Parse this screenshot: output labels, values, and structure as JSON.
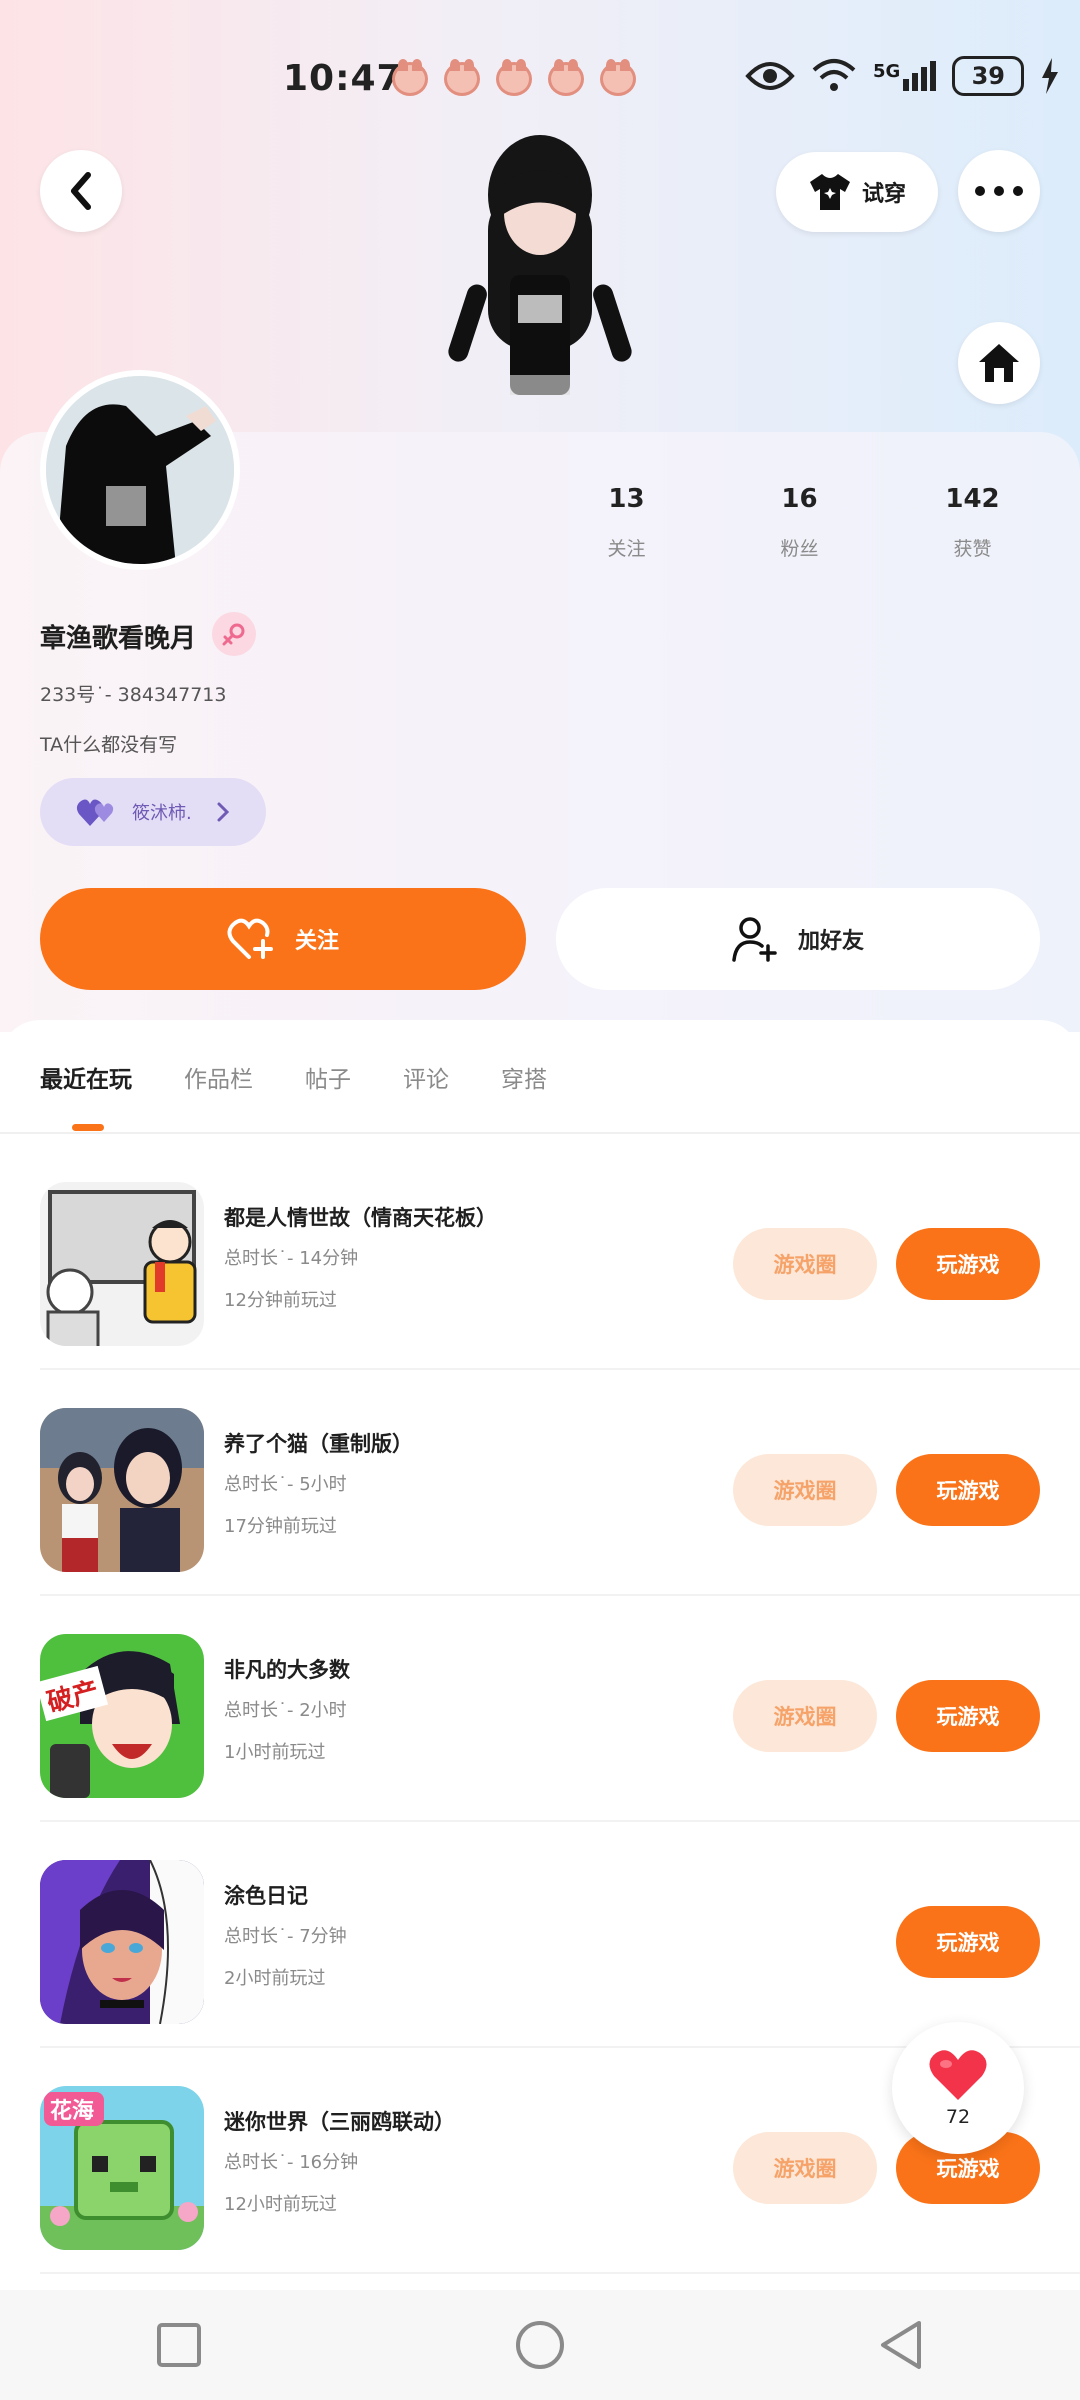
{
  "status_bar": {
    "time": "10:47",
    "network": "5G",
    "battery": "39"
  },
  "header": {
    "back_icon": "chevron-left-icon",
    "try_on_label": "试穿",
    "more_icon": "more-dots-icon",
    "home_icon": "home-icon"
  },
  "profile": {
    "nickname": "章渔歌看晚月",
    "uid": "233号˙- 384347713",
    "bio": "TA什么都没有写",
    "guard_name": "筱沭柿.",
    "stats": [
      {
        "value": "13",
        "label": "关注"
      },
      {
        "value": "16",
        "label": "粉丝"
      },
      {
        "value": "142",
        "label": "获赞"
      }
    ]
  },
  "actions": {
    "follow_label": "关注",
    "add_friend_label": "加好友"
  },
  "tabs": [
    "最近在玩",
    "作品栏",
    "帖子",
    "评论",
    "穿搭"
  ],
  "games": [
    {
      "name": "都是人情世故（情商天花板）",
      "duration": "总时长˙- 14分钟",
      "last_played": "12分钟前玩过",
      "circle_label": "游戏圈",
      "play_label": "玩游戏",
      "has_circle": true
    },
    {
      "name": "养了个猫（重制版）",
      "duration": "总时长˙- 5小时",
      "last_played": "17分钟前玩过",
      "circle_label": "游戏圈",
      "play_label": "玩游戏",
      "has_circle": true
    },
    {
      "name": "非凡的大多数",
      "duration": "总时长˙- 2小时",
      "last_played": "1小时前玩过",
      "circle_label": "游戏圈",
      "play_label": "玩游戏",
      "has_circle": true
    },
    {
      "name": "涂色日记",
      "duration": "总时长˙- 7分钟",
      "last_played": "2小时前玩过",
      "circle_label": "",
      "play_label": "玩游戏",
      "has_circle": false
    },
    {
      "name": "迷你世界（三丽鸥联动）",
      "duration": "总时长˙- 16分钟",
      "last_played": "12小时前玩过",
      "circle_label": "游戏圈",
      "play_label": "玩游戏",
      "has_circle": true
    }
  ],
  "game_thumb_text": {
    "game3": "破产",
    "game5": "花海"
  },
  "like_float": {
    "count": "72"
  },
  "colors": {
    "accent": "#fa7318",
    "chip_bg": "#fde7d8",
    "guard_bg": "#e4ddf6"
  }
}
